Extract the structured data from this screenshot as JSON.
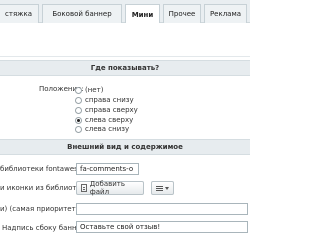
{
  "tabs": [
    {
      "label": "стяжка"
    },
    {
      "label": "Боковой баннер"
    },
    {
      "label": "Мини"
    },
    {
      "label": "Прочее"
    },
    {
      "label": "Реклама"
    }
  ],
  "where_section": {
    "title": "Где показывать?",
    "position_label": "Положение:",
    "options": [
      {
        "label": "(нет)",
        "checked": false
      },
      {
        "label": "справа снизу",
        "checked": false
      },
      {
        "label": "справа сверху",
        "checked": false
      },
      {
        "label": "слева сверху",
        "checked": true
      },
      {
        "label": "слева снизу",
        "checked": false
      }
    ]
  },
  "look_section": {
    "title": "Внешний вид и содержимое",
    "icon_lib_label": "библиотеки fontawesome:",
    "icon_lib_value": "fa-comments-o",
    "icon_file_label": "и иконки из библиотеки):",
    "add_file_label": "Добавить файл",
    "priority_label": "и) (самая приоритетная):",
    "priority_value": "",
    "side_text_label": "Надпись сбоку баннера:",
    "side_text_value": "Оставьте свой отзыв!"
  }
}
